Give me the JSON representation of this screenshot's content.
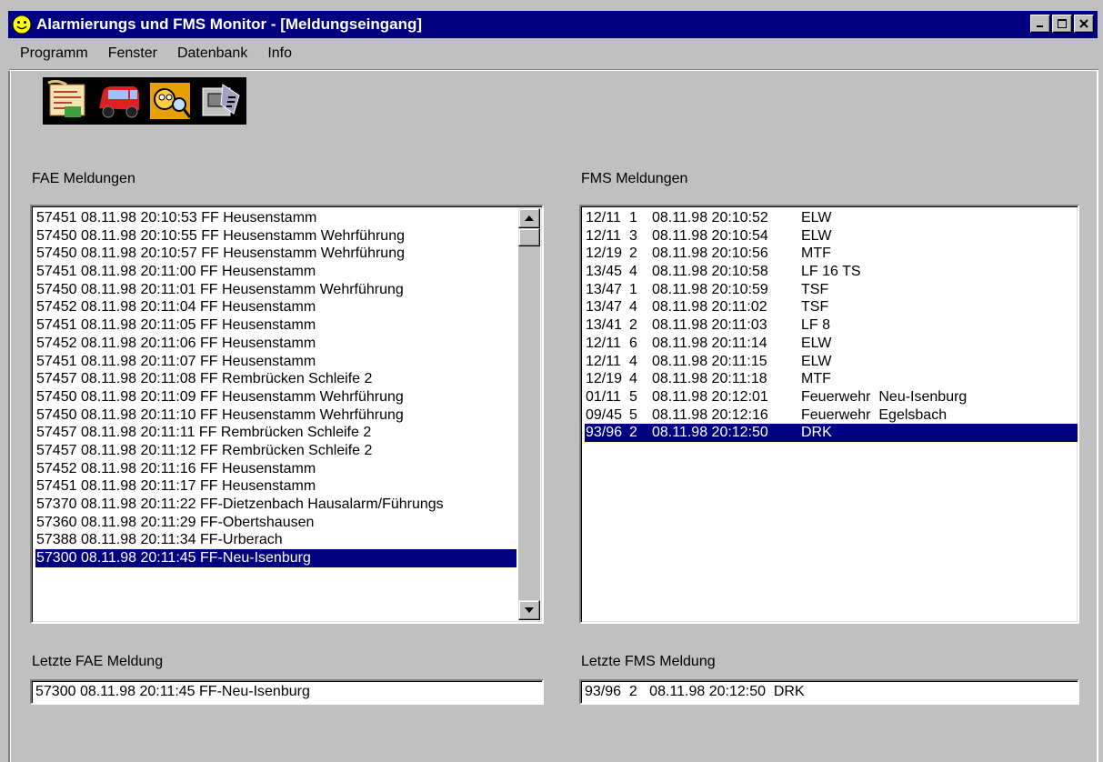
{
  "window": {
    "title": "Alarmierungs und FMS Monitor - [Meldungseingang]",
    "title_bar_color": "#000080",
    "selection_color": "#000080"
  },
  "menu": [
    "Programm",
    "Fenster",
    "Datenbank",
    "Info"
  ],
  "toolbar": {
    "icons": [
      "document-icon",
      "vehicle-icon",
      "person-search-icon",
      "database-icon"
    ]
  },
  "fae": {
    "title": "FAE Meldungen",
    "items": [
      "57451 08.11.98 20:10:53 FF Heusenstamm",
      "57450 08.11.98 20:10:55 FF Heusenstamm Wehrführung",
      "57450 08.11.98 20:10:57 FF Heusenstamm Wehrführung",
      "57451 08.11.98 20:11:00 FF Heusenstamm",
      "57450 08.11.98 20:11:01 FF Heusenstamm Wehrführung",
      "57452 08.11.98 20:11:04 FF Heusenstamm",
      "57451 08.11.98 20:11:05 FF Heusenstamm",
      "57452 08.11.98 20:11:06 FF Heusenstamm",
      "57451 08.11.98 20:11:07 FF Heusenstamm",
      "57457 08.11.98 20:11:08 FF Rembrücken Schleife 2",
      "57450 08.11.98 20:11:09 FF Heusenstamm Wehrführung",
      "57450 08.11.98 20:11:10 FF Heusenstamm Wehrführung",
      "57457 08.11.98 20:11:11 FF Rembrücken Schleife 2",
      "57457 08.11.98 20:11:12 FF Rembrücken Schleife 2",
      "57452 08.11.98 20:11:16 FF Heusenstamm",
      "57451 08.11.98 20:11:17 FF Heusenstamm",
      "57370 08.11.98 20:11:22 FF-Dietzenbach Hausalarm/Führungs",
      "57360 08.11.98 20:11:29 FF-Obertshausen",
      "57388 08.11.98 20:11:34 FF-Urberach",
      "57300 08.11.98 20:11:45 FF-Neu-Isenburg"
    ],
    "selected_index": 19
  },
  "fms": {
    "title": "FMS Meldungen",
    "items": [
      [
        "12/11",
        "1",
        "08.11.98 20:10:52",
        "ELW"
      ],
      [
        "12/11",
        "3",
        "08.11.98 20:10:54",
        "ELW"
      ],
      [
        "12/19",
        "2",
        "08.11.98 20:10:56",
        "MTF"
      ],
      [
        "13/45",
        "4",
        "08.11.98 20:10:58",
        "LF 16 TS"
      ],
      [
        "13/47",
        "1",
        "08.11.98 20:10:59",
        "TSF"
      ],
      [
        "13/47",
        "4",
        "08.11.98 20:11:02",
        "TSF"
      ],
      [
        "13/41",
        "2",
        "08.11.98 20:11:03",
        "LF 8"
      ],
      [
        "12/11",
        "6",
        "08.11.98 20:11:14",
        "ELW"
      ],
      [
        "12/11",
        "4",
        "08.11.98 20:11:15",
        "ELW"
      ],
      [
        "12/19",
        "4",
        "08.11.98 20:11:18",
        "MTF"
      ],
      [
        "01/11",
        "5",
        "08.11.98 20:12:01",
        "Feuerwehr  Neu-Isenburg"
      ],
      [
        "09/45",
        "5",
        "08.11.98 20:12:16",
        "Feuerwehr  Egelsbach"
      ],
      [
        "93/96",
        "2",
        "08.11.98 20:12:50",
        "DRK"
      ]
    ],
    "selected_index": 12
  },
  "last_fae": {
    "label": "Letzte FAE Meldung",
    "value": "57300 08.11.98 20:11:45 FF-Neu-Isenburg"
  },
  "last_fms": {
    "label": "Letzte FMS Meldung",
    "value": "93/96  2   08.11.98 20:12:50  DRK"
  }
}
